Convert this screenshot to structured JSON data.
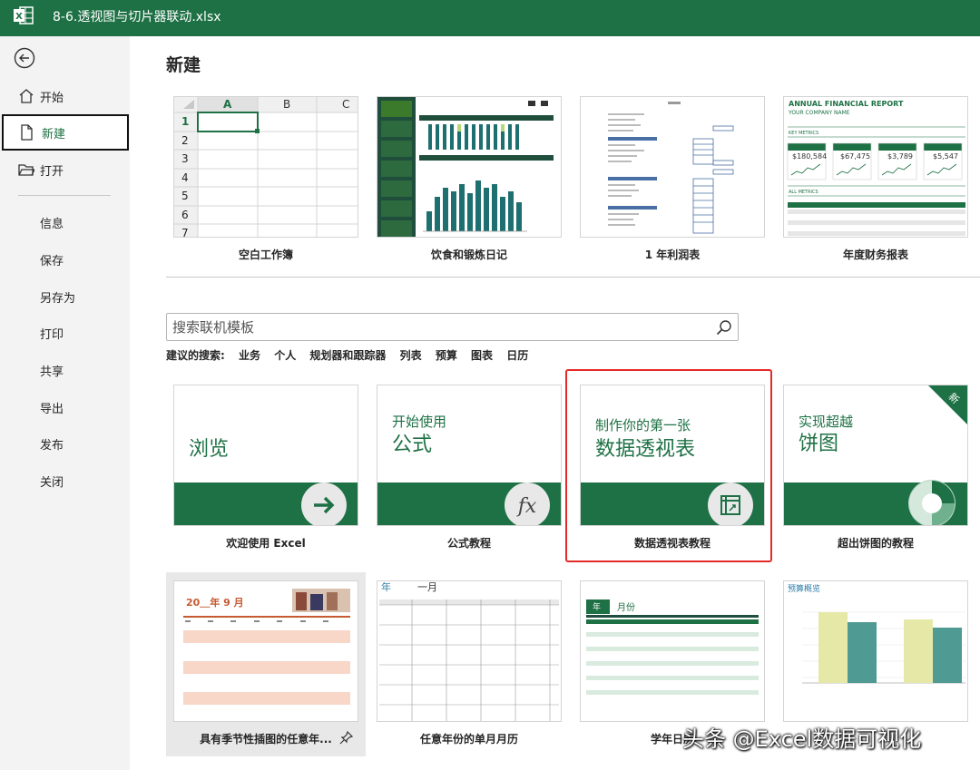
{
  "window": {
    "title": "8-6.透视图与切片器联动.xlsx"
  },
  "nav": {
    "home": "开始",
    "new": "新建",
    "open": "打开",
    "sub": [
      "信息",
      "保存",
      "另存为",
      "打印",
      "共享",
      "导出",
      "发布",
      "关闭"
    ]
  },
  "page_title": "新建",
  "featured": [
    {
      "caption": "空白工作簿"
    },
    {
      "caption": "饮食和锻炼日记"
    },
    {
      "caption": "1 年利润表"
    },
    {
      "caption": "年度财务报表"
    }
  ],
  "blank_grid": {
    "columns": [
      "A",
      "B",
      "C"
    ],
    "rows": [
      "1",
      "2",
      "3",
      "4",
      "5",
      "6",
      "7"
    ]
  },
  "finance_thumb": {
    "title": "ANNUAL FINANCIAL REPORT",
    "company": "YOUR COMPANY NAME",
    "key_metrics": "KEY METRICS",
    "all_metrics": "ALL METRICS",
    "values": [
      "$180,584",
      "$67,475",
      "$3,789",
      "$5,547"
    ]
  },
  "search": {
    "placeholder": "搜索联机模板"
  },
  "suggested": {
    "label": "建议的搜索:",
    "items": [
      "业务",
      "个人",
      "规划器和跟踪器",
      "列表",
      "预算",
      "图表",
      "日历"
    ]
  },
  "tutorials": [
    {
      "line1": "",
      "line2": "浏览",
      "caption": "欢迎使用 Excel",
      "icon": "arrow-right-icon"
    },
    {
      "line1": "开始使用",
      "line2": "公式",
      "caption": "公式教程",
      "icon": "function-fx-icon"
    },
    {
      "line1": "制作你的第一张",
      "line2": "数据透视表",
      "caption": "数据透视表教程",
      "icon": "pivot-table-icon"
    },
    {
      "line1": "实现超越",
      "line2": "饼图",
      "caption": "超出饼图的教程",
      "icon": "pie-chart-icon",
      "badge": "新"
    }
  ],
  "bottom": [
    {
      "caption": "具有季节性插图的任意年...",
      "header": "20＿年 9 月"
    },
    {
      "caption": "任意年份的单月月历",
      "header_year": "年",
      "header_month": "一月"
    },
    {
      "caption": "学年日历",
      "header_year": "年",
      "header_month": "月份"
    },
    {
      "caption": "",
      "header": "预算概览"
    }
  ],
  "watermark": "头条 @Excel数据可视化",
  "colors": {
    "brand": "#1e7145",
    "highlight": "#e52a2a"
  }
}
